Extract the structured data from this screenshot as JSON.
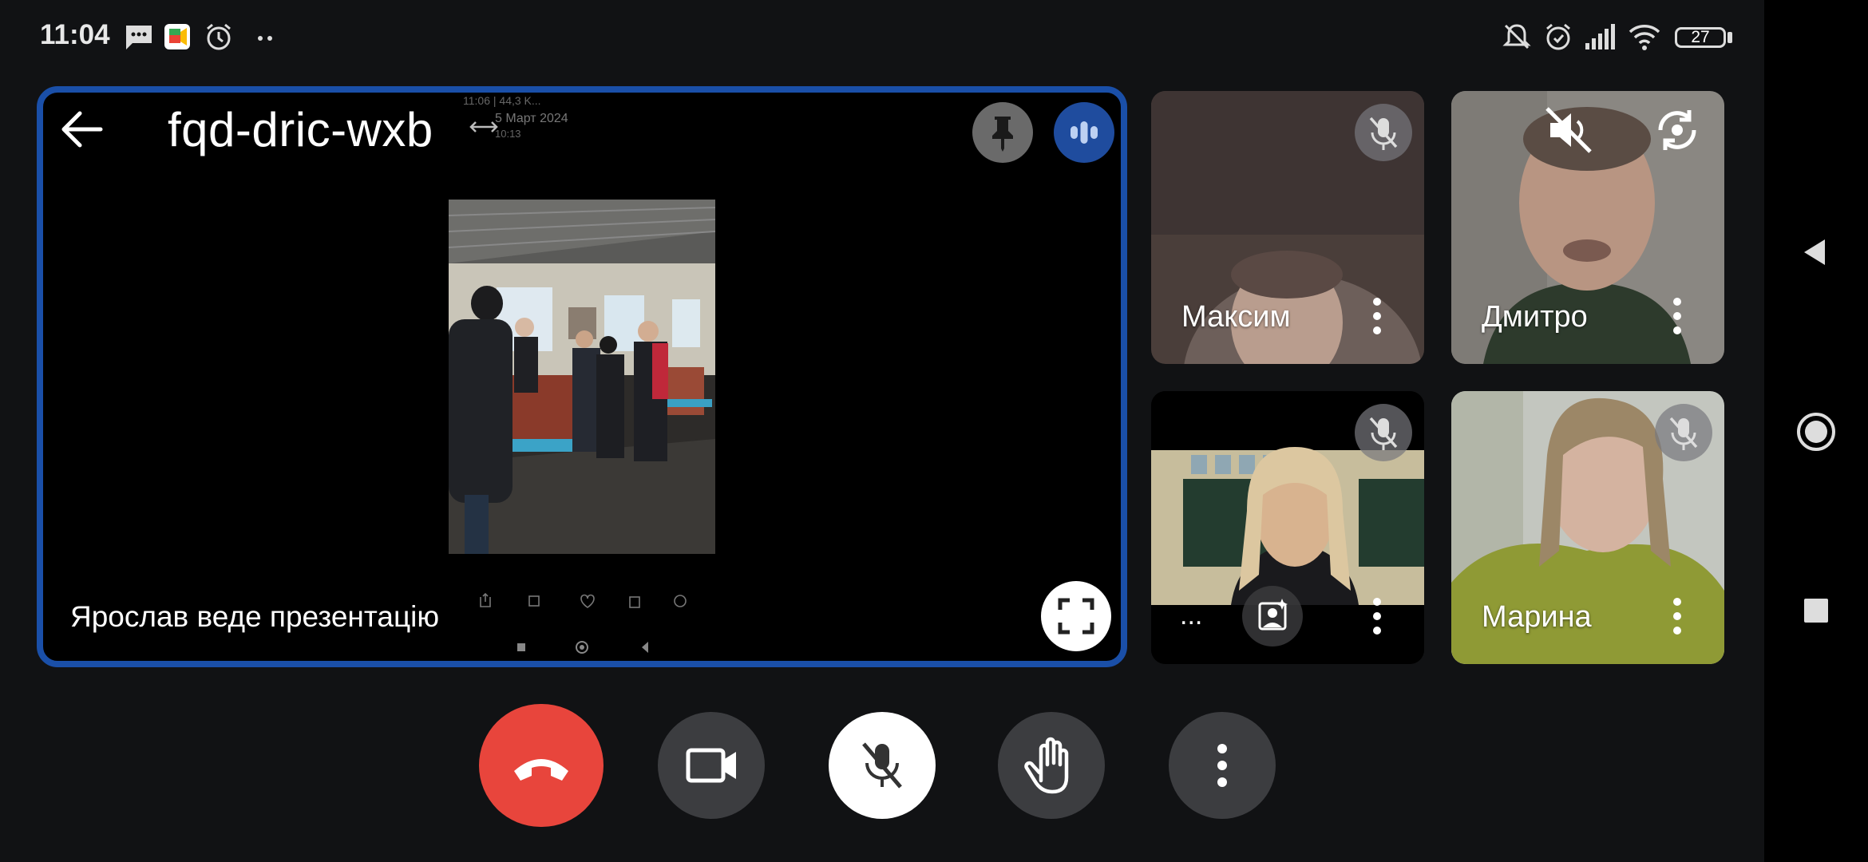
{
  "status_bar": {
    "time": "11:04",
    "battery": "27",
    "icons": [
      "messages-icon",
      "google-meet-icon",
      "alarm-icon",
      "more-dots-icon",
      "vibrate-off-icon",
      "alarm-icon",
      "signal-icon",
      "wifi-icon",
      "battery-icon"
    ]
  },
  "meeting": {
    "code": "fqd-dric-wxb",
    "presenter_label": "Ярослав веде презентацію"
  },
  "shared_screen": {
    "mini_status": "11:06 | 44,3 K...",
    "date": "5 Март 2024",
    "time": "10:13"
  },
  "participants": [
    {
      "name": "Максим",
      "muted": true
    },
    {
      "name": "Дмитро",
      "muted": false
    },
    {
      "name": "...",
      "muted": true
    },
    {
      "name": "Марина",
      "muted": true
    }
  ],
  "controls": {
    "end_call": "end-call",
    "camera": "camera",
    "mic": "mic-muted",
    "raise_hand": "raise-hand",
    "more": "more-options"
  },
  "colors": {
    "accent_blue": "#1a4fa8",
    "end_call_red": "#e8453c",
    "control_gray": "#3c3d40",
    "background": "#111214"
  }
}
